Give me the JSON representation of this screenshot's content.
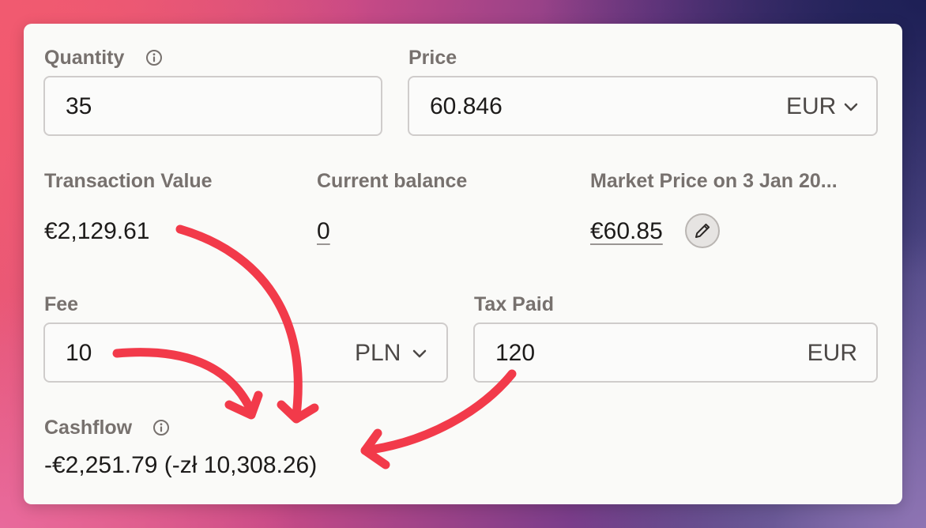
{
  "quantity": {
    "label": "Quantity",
    "value": "35"
  },
  "price": {
    "label": "Price",
    "value": "60.846",
    "currency": "EUR"
  },
  "transaction_value": {
    "label": "Transaction Value",
    "value": "€2,129.61"
  },
  "current_balance": {
    "label": "Current balance",
    "value": "0"
  },
  "market_price": {
    "label": "Market Price on 3 Jan 20...",
    "value": "€60.85"
  },
  "fee": {
    "label": "Fee",
    "value": "10",
    "currency": "PLN"
  },
  "tax_paid": {
    "label": "Tax Paid",
    "value": "120",
    "currency": "EUR"
  },
  "cashflow": {
    "label": "Cashflow",
    "value": "-€2,251.79 (-zł 10,308.26)"
  },
  "colors": {
    "arrow": "#f23a4a",
    "label": "#77716e",
    "border": "#cfcccb"
  },
  "icons": [
    "info-icon",
    "chevron-down-icon",
    "pencil-icon"
  ]
}
